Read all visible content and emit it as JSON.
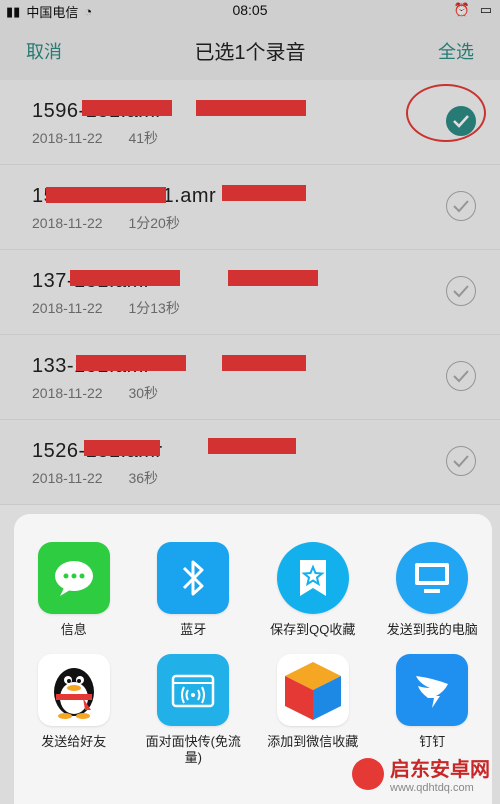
{
  "status": {
    "carrier": "中国电信",
    "time": "08:05"
  },
  "nav": {
    "cancel": "取消",
    "title": "已选1个录音",
    "select_all": "全选"
  },
  "recordings": [
    {
      "name": "1596-181.amr",
      "date": "2018-11-22",
      "duration": "41秒",
      "selected": true
    },
    {
      "name": "1591-5365-181.amr",
      "date": "2018-11-22",
      "duration": "1分20秒",
      "selected": false
    },
    {
      "name": "137-181.amr",
      "date": "2018-11-22",
      "duration": "1分13秒",
      "selected": false
    },
    {
      "name": "133-181.amr",
      "date": "2018-11-22",
      "duration": "30秒",
      "selected": false
    },
    {
      "name": "1526-181.amr",
      "date": "2018-11-22",
      "duration": "36秒",
      "selected": false
    }
  ],
  "share": {
    "items": [
      {
        "label": "信息",
        "icon": "message-icon",
        "color": "#2ecc40"
      },
      {
        "label": "蓝牙",
        "icon": "bluetooth-icon",
        "color": "#1aa3ef"
      },
      {
        "label": "保存到QQ收藏",
        "icon": "qq-favorites-icon",
        "color": "#13b0ee"
      },
      {
        "label": "发送到我的电脑",
        "icon": "my-computer-icon",
        "color": "#22a5f2"
      },
      {
        "label": "发送给好友",
        "icon": "qq-penguin-icon",
        "color": "#ffffff"
      },
      {
        "label": "面对面快传(免流量)",
        "icon": "face-transfer-icon",
        "color": "#22b0e8"
      },
      {
        "label": "添加到微信收藏",
        "icon": "wechat-favorites-icon",
        "color": "#ffffff"
      },
      {
        "label": "钉钉",
        "icon": "dingtalk-icon",
        "color": "#1f8ff0"
      }
    ]
  },
  "watermark": {
    "brand": "启东安卓网",
    "url": "www.qdhtdq.com"
  }
}
